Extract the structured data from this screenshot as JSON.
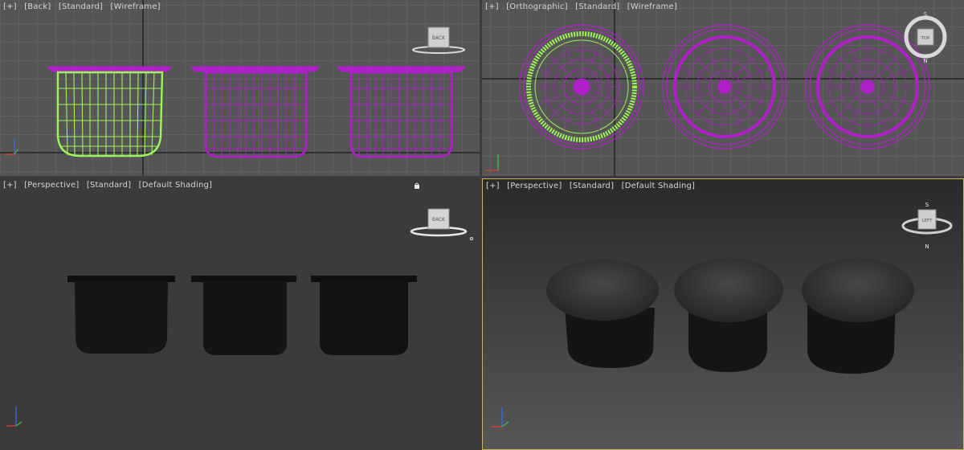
{
  "viewports": [
    {
      "labels": [
        "[+]",
        "[Back]",
        "[Standard]",
        "[Wireframe]"
      ],
      "cube_label": "BACK"
    },
    {
      "labels": [
        "[+]",
        "[Orthographic]",
        "[Standard]",
        "[Wireframe]"
      ],
      "cube_label": "TOP",
      "compass": {
        "n": "N",
        "s": "S"
      }
    },
    {
      "labels": [
        "[+]",
        "[Perspective]",
        "[Standard]",
        "[Default Shading]"
      ],
      "cube_label": "BACK"
    },
    {
      "labels": [
        "[+]",
        "[Perspective]",
        "[Standard]",
        "[Default Shading]"
      ],
      "cube_label": "LEFT",
      "compass": {
        "n": "N",
        "s": "S"
      }
    }
  ],
  "colors": {
    "selected_wire": "#9ef55a",
    "unselected_wire": "#b020c8",
    "active_border": "#c9b65a",
    "grid": "#5a5a5a",
    "grid_major": "#1a1a1a"
  },
  "icons": {
    "viewcube": "viewcube-icon",
    "axis_tripod": "axis-tripod-icon",
    "compass": "compass-icon"
  }
}
